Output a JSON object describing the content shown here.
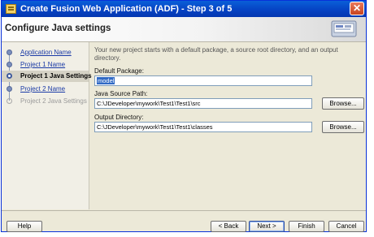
{
  "window": {
    "title": "Create Fusion Web Application (ADF) - Step 3 of 5",
    "close_glyph": "✕"
  },
  "header": {
    "heading": "Configure Java settings",
    "art_icon": "project-settings-illustration"
  },
  "nav": {
    "items": [
      {
        "label": "Application Name",
        "state": "done"
      },
      {
        "label": "Project 1 Name",
        "state": "done"
      },
      {
        "label": "Project 1 Java Settings",
        "state": "current"
      },
      {
        "label": "Project 2 Name",
        "state": "done"
      },
      {
        "label": "Project 2 Java Settings",
        "state": "future"
      }
    ]
  },
  "form": {
    "description": "Your new project starts with a default package, a source root directory, and an output directory.",
    "default_package": {
      "label": "Default Package:",
      "value": "model"
    },
    "java_source_path": {
      "label": "Java Source Path:",
      "value": "C:\\JDeveloper\\mywork\\Test1\\Test1\\src"
    },
    "output_directory": {
      "label": "Output Directory:",
      "value": "C:\\JDeveloper\\mywork\\Test1\\Test1\\classes"
    },
    "browse_label": "Browse..."
  },
  "buttons": {
    "help": "Help",
    "back": "< Back",
    "next": "Next >",
    "finish": "Finish",
    "cancel": "Cancel"
  },
  "colors": {
    "titlebar": "#0a5fd8",
    "dialog_bg": "#ece9d8",
    "selection": "#316ac5",
    "link": "#1a3aa6"
  }
}
